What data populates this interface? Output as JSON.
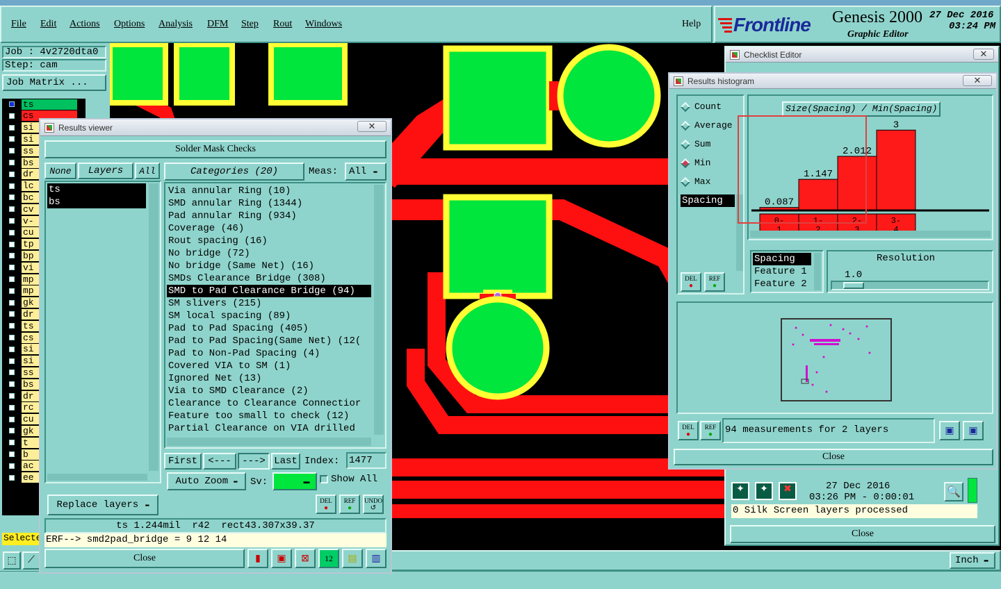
{
  "menubar": {
    "items": [
      "File",
      "Edit",
      "Actions",
      "Options",
      "Analysis",
      "DFM",
      "Step",
      "Rout",
      "Windows"
    ],
    "help": "Help"
  },
  "brand": {
    "logo": "Frontline",
    "product": "Genesis 2000",
    "subtitle": "Graphic Editor",
    "date": "27 Dec 2016",
    "time": "03:24 PM"
  },
  "job": {
    "job_label": "Job : 4v2720dta0",
    "step_label": "Step: cam",
    "matrix_button": "Job Matrix ..."
  },
  "left_layers": {
    "rows": [
      "ts",
      "cs",
      "si",
      "si",
      "ss",
      "bs",
      "dr",
      "lc",
      "bc",
      "cv",
      "v-",
      "cu",
      "tp",
      "bp",
      "vi",
      "mp",
      "mp",
      "gk",
      "dr",
      "ts",
      "cs",
      "si",
      "si",
      "ss",
      "bs",
      "dr",
      "rc",
      "cu",
      "gk",
      "t",
      "b",
      "ac",
      "ee"
    ],
    "selected_label": "Selecte"
  },
  "results_viewer": {
    "title": "Results viewer",
    "heading": "Solder Mask Checks",
    "none_btn": "None",
    "layers_btn": "Layers",
    "all_btn": "All",
    "categories_btn": "Categories (20)",
    "meas_label": "Meas:",
    "meas_value": "All",
    "layers": [
      "ts",
      "bs"
    ],
    "categories": [
      "Via annular Ring (10)",
      "SMD annular Ring (1344)",
      "Pad annular Ring (934)",
      "Coverage (46)",
      "Rout spacing (16)",
      "No bridge (72)",
      "No bridge (Same Net) (16)",
      "SMDs Clearance Bridge (308)",
      "SMD to Pad Clearance Bridge (94)",
      "SM slivers (215)",
      "SM local spacing (89)",
      "Pad to Pad Spacing (405)",
      "Pad to Pad Spacing(Same Net) (12(",
      "Pad to Non-Pad Spacing (4)",
      "Covered VIA to SM (1)",
      "Ignored Net (13)",
      "Via to SMD Clearance (2)",
      "Clearance to Clearance Connectior",
      "Feature too small to check (12)",
      "Partial Clearance on VIA drilled"
    ],
    "selected_index": 8,
    "first_btn": "First",
    "prev_btn": "<---",
    "next_btn": "--->",
    "last_btn": "Last",
    "index_label": "Index:",
    "index_value": "1477",
    "autozoom_btn": "Auto Zoom",
    "sv_label": "Sv:",
    "show_all": "Show All",
    "replace_layers": "Replace layers",
    "del": "DEL",
    "ref": "REF",
    "undo": "UNDO",
    "info_line": "ts 1.244mil  r42  rect43.307x39.37",
    "erf_line": "ERF--> smd2pad_bridge = 9 12 14",
    "close": "Close"
  },
  "checklist_editor": {
    "title": "Checklist Editor",
    "date": "27 Dec 2016",
    "time": "03:26 PM - 0:00:01",
    "status": "0 Silk Screen layers processed",
    "close": "Close"
  },
  "histogram": {
    "title": "Results histogram",
    "options": [
      "Count",
      "Average",
      "Sum",
      "Min",
      "Max"
    ],
    "selected_option": "Min",
    "measure_list": [
      "Spacing"
    ],
    "chart_title": "Size(Spacing) / Min(Spacing)",
    "fields": [
      "Spacing",
      "Feature 1",
      "Feature 2"
    ],
    "resolution_label": "Resolution",
    "resolution_value": "1.0",
    "summary": "94 measurements for 2 layers",
    "del": "DEL",
    "ref": "REF",
    "close": "Close"
  },
  "chart_data": {
    "type": "bar",
    "title": "Size(Spacing) / Min(Spacing)",
    "categories": [
      "0-1",
      "1-2",
      "2-3",
      "3-4"
    ],
    "category_top": [
      "0-",
      "1-",
      "2-",
      "3-"
    ],
    "category_bottom": [
      "1",
      "2",
      "3",
      "4"
    ],
    "values": [
      0.087,
      1.147,
      2.012,
      3
    ],
    "value_labels": [
      "0.087",
      "1.147",
      "2.012",
      "3"
    ],
    "ylim": [
      0,
      3.4
    ],
    "grid": false,
    "bar_color": "#ff1a1a"
  },
  "status_bar": {
    "unit": "Inch"
  },
  "colors": {
    "board_bg": "#000000",
    "pad": "#00e63c",
    "pad_ring": "#ffff33",
    "trace": "#ff1010",
    "ui_bg": "#8fd4cc"
  }
}
